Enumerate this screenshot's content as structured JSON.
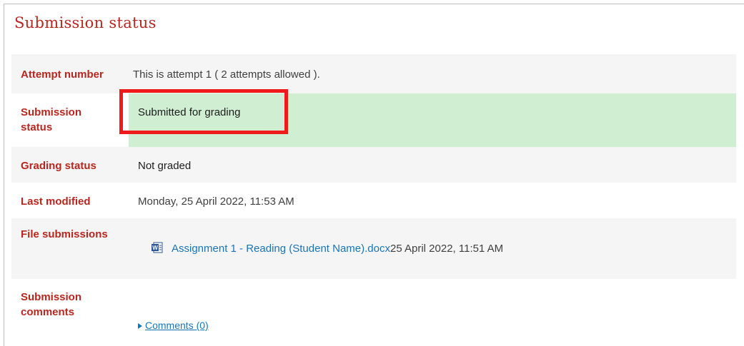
{
  "page": {
    "title": "Submission status"
  },
  "rows": {
    "attempt": {
      "label": "Attempt number",
      "value": "This is attempt 1 ( 2 attempts allowed )."
    },
    "submission_status": {
      "label_line1": "Submission",
      "label_line2": "status",
      "value": "Submitted for grading"
    },
    "grading": {
      "label": "Grading status",
      "value": "Not graded"
    },
    "modified": {
      "label": "Last modified",
      "value": "Monday, 25 April 2022, 11:53 AM"
    },
    "files": {
      "label": "File submissions",
      "file_name": "Assignment 1 - Reading (Student Name).docx",
      "file_date": "25 April 2022, 11:51 AM",
      "file_icon": "word-icon"
    },
    "comments": {
      "label_line1": "Submission",
      "label_line2": "comments",
      "link": "Comments (0)"
    }
  },
  "colors": {
    "accent_red": "#b7271f",
    "success_bg": "#cfeed2",
    "link_blue": "#1a75b8",
    "highlight": "#ef1b1b"
  }
}
